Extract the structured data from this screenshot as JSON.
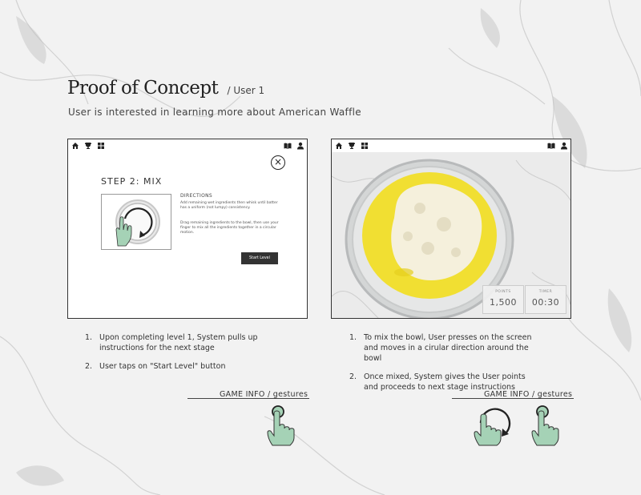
{
  "header": {
    "title": "Proof of Concept",
    "title_suffix": "/ User 1",
    "subtitle": "User is interested in learning more about American Waffle"
  },
  "left_screen": {
    "nav_icons": [
      "home-icon",
      "trophy-icon",
      "grid-icon",
      "book-icon",
      "user-icon"
    ],
    "close_symbol": "×",
    "step_title": "STEP 2: MIX",
    "directions_heading": "DIRECTIONS",
    "directions_1": "Add remaining wet ingredients then whisk until batter has a uniform (not lumpy) consistency.",
    "directions_2": "Drag remaining ingredients to the bowl, then use your finger to mix all the ingredients together in a circular motion.",
    "start_button": "Start Level"
  },
  "right_screen": {
    "nav_icons": [
      "home-icon",
      "trophy-icon",
      "grid-icon",
      "book-icon",
      "user-icon"
    ],
    "points_label": "POINTS",
    "points_value": "1,500",
    "timer_label": "TIMER",
    "timer_value": "00:30"
  },
  "left_steps": [
    {
      "num": "1.",
      "text": "Upon completing level 1, System pulls up instructions for the next stage"
    },
    {
      "num": "2.",
      "text": "User taps on \"Start Level\" button"
    }
  ],
  "right_steps": [
    {
      "num": "1.",
      "text": "To mix the bowl, User presses on the screen and moves in a cirular direction around the bowl"
    },
    {
      "num": "2.",
      "text": "Once mixed, System gives the User points and proceeds to next stage instructions"
    }
  ],
  "game_info_left": "GAME INFO / gestures",
  "game_info_right": "GAME INFO / gestures",
  "colors": {
    "hand_fill": "#a5d2b6",
    "hand_stroke": "#333333",
    "batter": "#f1df32",
    "dough": "#f5f0dc",
    "button": "#333333"
  }
}
